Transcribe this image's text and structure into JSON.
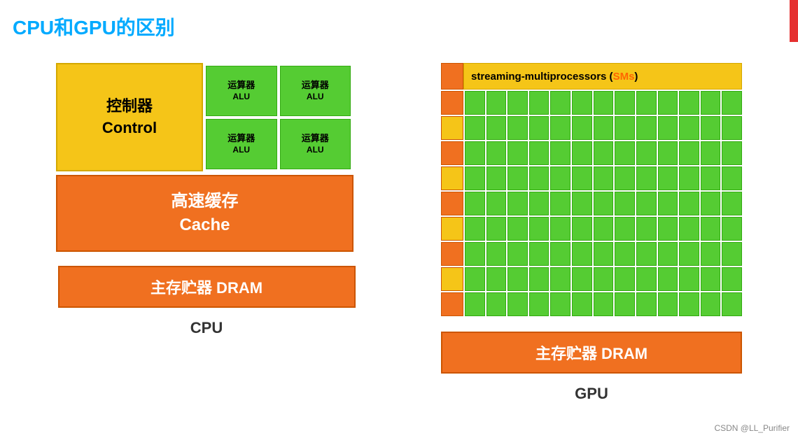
{
  "title": "CPU和GPU的区别",
  "redbar": true,
  "cpu": {
    "control_zh": "控制器",
    "control_en": "Control",
    "alu_zh": "运算器",
    "alu_en": "ALU",
    "cache_zh": "高速缓存",
    "cache_en": "Cache",
    "dram": "主存贮器 DRAM",
    "label": "CPU",
    "alu_count": 4
  },
  "gpu": {
    "sm_label": "streaming-multiprocessors (",
    "sm_sms": "SMs",
    "sm_close": ")",
    "rows": 9,
    "cols": 13,
    "row_colors": [
      "orange",
      "yellow",
      "orange",
      "yellow",
      "orange",
      "yellow",
      "orange",
      "yellow",
      "orange"
    ],
    "dram": "主存贮器 DRAM",
    "label": "GPU"
  },
  "watermark": "CSDN @LL_Purifier"
}
